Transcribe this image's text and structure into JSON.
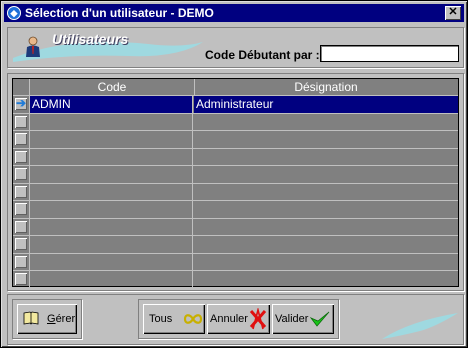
{
  "window": {
    "title": "Sélection d'un utilisateur - DEMO",
    "close_label": "✕"
  },
  "header": {
    "title": "Utilisateurs",
    "code_label": "Code Débutant par :",
    "code_value": ""
  },
  "grid": {
    "columns": [
      "Code",
      "Désignation"
    ],
    "rows": [
      {
        "code": "ADMIN",
        "designation": "Administrateur",
        "selected": true
      },
      {
        "code": "",
        "designation": ""
      },
      {
        "code": "",
        "designation": ""
      },
      {
        "code": "",
        "designation": ""
      },
      {
        "code": "",
        "designation": ""
      },
      {
        "code": "",
        "designation": ""
      },
      {
        "code": "",
        "designation": ""
      },
      {
        "code": "",
        "designation": ""
      },
      {
        "code": "",
        "designation": ""
      },
      {
        "code": "",
        "designation": ""
      },
      {
        "code": "",
        "designation": ""
      }
    ]
  },
  "buttons": {
    "gerer": {
      "prefix": "",
      "underlined": "G",
      "suffix": "érer",
      "icon": "book-icon"
    },
    "tous": {
      "label": "Tous",
      "icon": "infinity-icon"
    },
    "annuler": {
      "label": "Annuler",
      "icon": "cancel-x-icon"
    },
    "valider": {
      "label": "Valider",
      "icon": "checkmark-icon"
    }
  },
  "colors": {
    "titlebar": "#000080",
    "selection": "#000080",
    "grid_bg": "#808080",
    "face": "#c0c0c0"
  }
}
